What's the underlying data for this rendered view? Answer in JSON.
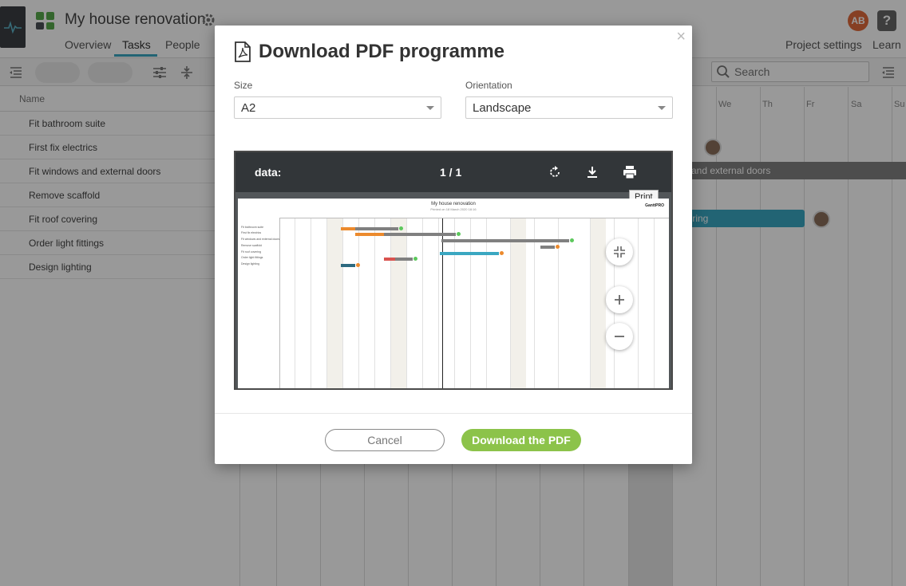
{
  "app": {
    "project_title": "My house renovation",
    "nav_tabs": [
      {
        "label": "Overview"
      },
      {
        "label": "Tasks"
      },
      {
        "label": "People"
      }
    ],
    "project_settings_label": "Project settings",
    "learn_label": "Learn",
    "user_initials": "AB",
    "help_label": "?",
    "search_placeholder": "Search",
    "name_column_header": "Name",
    "tasks": [
      {
        "name": "Fit bathroom suite"
      },
      {
        "name": "First fix electrics"
      },
      {
        "name": "Fit windows and external doors"
      },
      {
        "name": "Remove scaffold"
      },
      {
        "name": "Fit roof covering"
      },
      {
        "name": "Order light fittings"
      },
      {
        "name": "Design lighting"
      }
    ],
    "day_labels": [
      "We",
      "Th",
      "Fr",
      "Sa",
      "Su"
    ],
    "visible_bar_labels": {
      "windows": "ws and external doors",
      "roof": "overing"
    }
  },
  "modal": {
    "title": "Download PDF programme",
    "close_label": "×",
    "size_label": "Size",
    "size_value": "A2",
    "orientation_label": "Orientation",
    "orientation_value": "Landscape",
    "viewer": {
      "file_name": "data:",
      "page_indicator": "1 / 1",
      "tooltip": "Print",
      "page_title": "My house renovation",
      "page_subtitle": "Printed on 18 March 2020 18:16",
      "page_logo": "GanttPRO"
    },
    "cancel_label": "Cancel",
    "download_label": "Download the PDF"
  },
  "colors": {
    "accent_blue": "#3aa7c1",
    "download_green": "#8cc34a",
    "bar_orange": "#ec8a2d",
    "bar_gray": "#808080",
    "bar_teal": "#3aa7c1",
    "bar_red": "#d9534f",
    "bar_navy": "#2d6a80",
    "milestone_green": "#5cc85c"
  }
}
